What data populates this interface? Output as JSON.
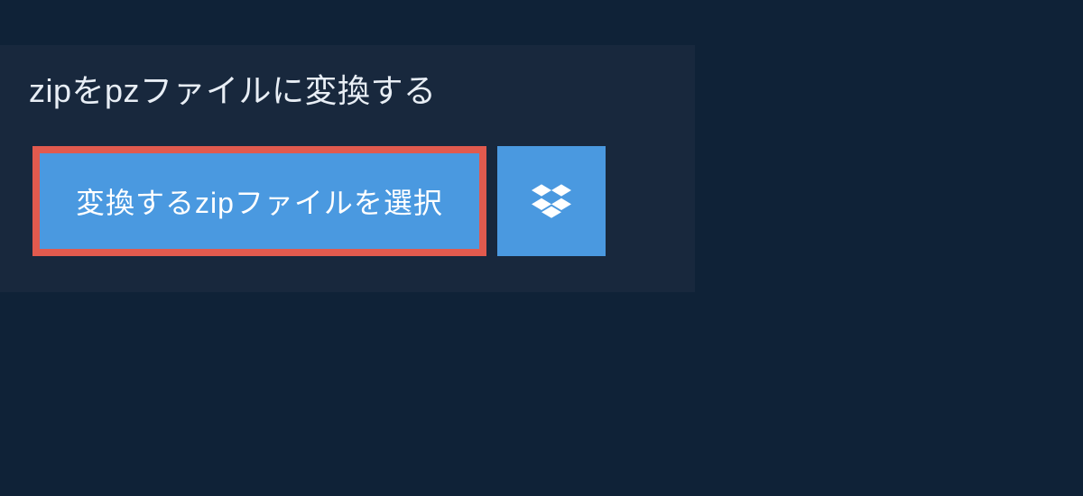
{
  "header": {
    "title": "zipをpzファイルに変換する"
  },
  "actions": {
    "select_file_label": "変換するzipファイルを選択"
  },
  "colors": {
    "background": "#0f2237",
    "panel": "#18283d",
    "button": "#4a99e0",
    "highlight_border": "#e15a4e",
    "text": "#e8eef5"
  }
}
